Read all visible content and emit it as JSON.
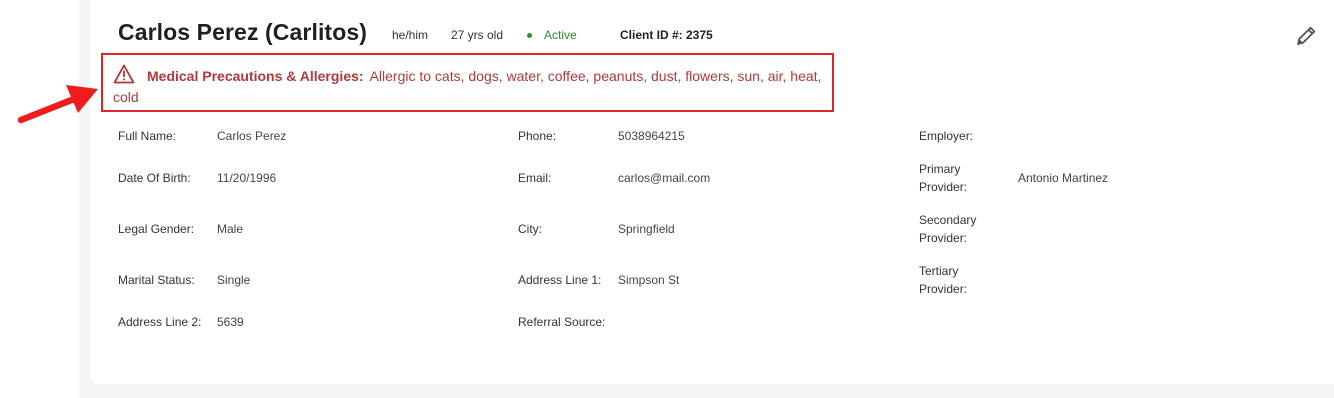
{
  "header": {
    "name": "Carlos Perez (Carlitos)",
    "pronouns": "he/him",
    "age": "27 yrs old",
    "status": "Active",
    "client_id": "Client ID #: 2375",
    "edit_icon": "pencil-icon"
  },
  "alert": {
    "icon": "warning-triangle-icon",
    "label": "Medical Precautions & Allergies:",
    "text": "Allergic to cats, dogs, water, coffee, peanuts, dust, flowers, sun, air, heat, cold"
  },
  "fields": {
    "full_name": {
      "label": "Full Name:",
      "value": "Carlos Perez"
    },
    "dob": {
      "label": "Date Of Birth:",
      "value": "11/20/1996"
    },
    "legal_gender": {
      "label": "Legal Gender:",
      "value": "Male"
    },
    "marital_status": {
      "label": "Marital Status:",
      "value": "Single"
    },
    "address_line_2": {
      "label": "Address Line 2:",
      "value": "5639"
    },
    "phone": {
      "label": "Phone:",
      "value": "5038964215"
    },
    "email": {
      "label": "Email:",
      "value": "carlos@mail.com"
    },
    "city": {
      "label": "City:",
      "value": "Springfield"
    },
    "address_line_1": {
      "label": "Address Line 1:",
      "value": "Simpson St"
    },
    "referral_source": {
      "label": "Referral Source:",
      "value": ""
    },
    "employer": {
      "label": "Employer:",
      "value": ""
    },
    "primary_provider": {
      "label_1": "Primary",
      "label_2": "Provider:",
      "value": "Antonio Martinez"
    },
    "secondary_provider": {
      "label_1": "Secondary",
      "label_2": "Provider:",
      "value": ""
    },
    "tertiary_provider": {
      "label_1": "Tertiary",
      "label_2": "Provider:",
      "value": ""
    }
  },
  "colors": {
    "accent_red": "#e0242b",
    "alert_text": "#b03a3a",
    "status_green": "#2e8b2e"
  }
}
